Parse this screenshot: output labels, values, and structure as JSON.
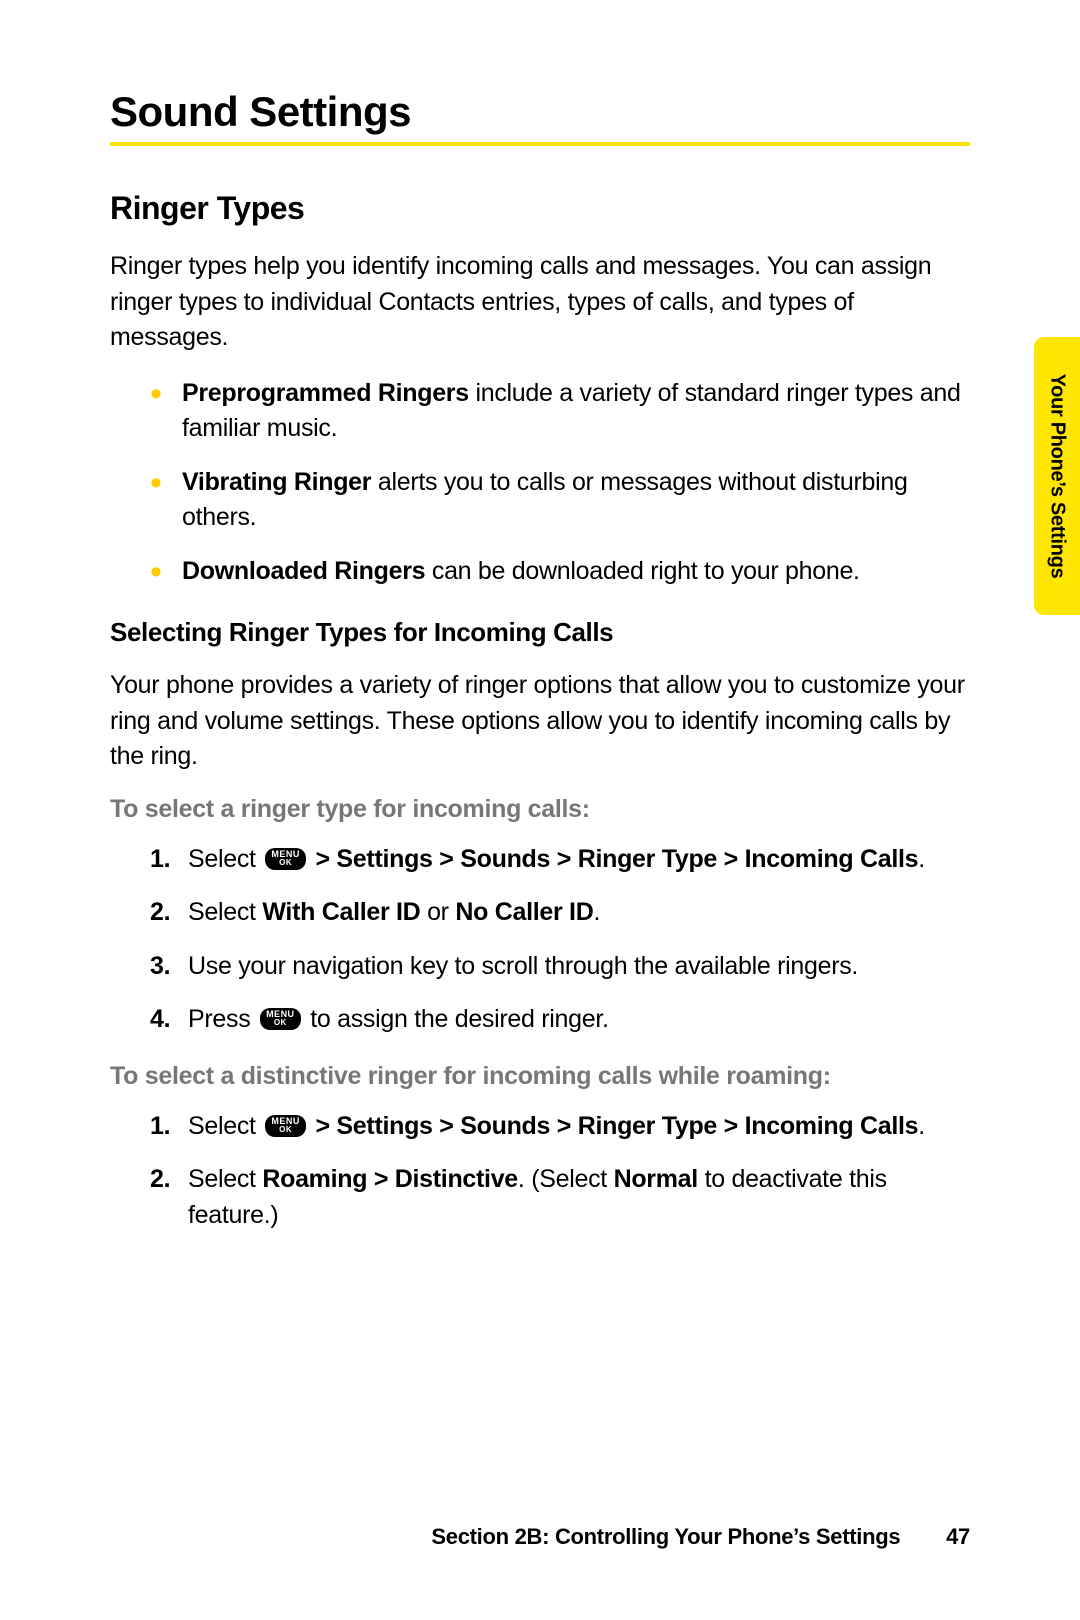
{
  "headings": {
    "main": "Sound Settings",
    "sub": "Ringer Types",
    "minor": "Selecting Ringer Types for Incoming Calls"
  },
  "intro_para": "Ringer types help you identify incoming calls and messages. You can assign ringer types to individual Contacts entries, types of calls, and types of messages.",
  "bullets": {
    "b1_bold": "Preprogrammed Ringers",
    "b1_rest": " include a variety of standard ringer types and familiar music.",
    "b2_bold": "Vibrating Ringer",
    "b2_rest": " alerts you to calls or messages without disturbing others.",
    "b3_bold": "Downloaded Ringers",
    "b3_rest": " can be downloaded right to your phone."
  },
  "selecting_para": "Your phone provides a variety of ringer options that allow you to customize your ring and volume settings. These options allow you to identify incoming calls by the ring.",
  "task1_heading": "To select a ringer type for incoming calls:",
  "task1": {
    "s1_pre": "Select ",
    "s1_path": " > Settings > Sounds > Ringer Type > Incoming Calls",
    "s1_end": ".",
    "s2_pre": "Select ",
    "s2_b1": "With Caller ID",
    "s2_mid": " or ",
    "s2_b2": "No Caller ID",
    "s2_end": ".",
    "s3": "Use your navigation key to scroll through the available ringers.",
    "s4_pre": "Press ",
    "s4_post": " to assign the desired ringer."
  },
  "task2_heading": "To select a distinctive ringer for incoming calls while roaming:",
  "task2": {
    "s1_pre": "Select ",
    "s1_path": " > Settings > Sounds > Ringer Type > Incoming Calls",
    "s1_end": ".",
    "s2_pre": "Select ",
    "s2_b1": "Roaming > Distinctive",
    "s2_mid": ". (Select ",
    "s2_b2": "Normal",
    "s2_end": " to deactivate this feature.)"
  },
  "key": {
    "top": "MENU",
    "bot": "OK"
  },
  "side_tab": "Your Phone’s Settings",
  "footer": {
    "section": "Section 2B: Controlling Your Phone’s Settings",
    "page": "47"
  }
}
